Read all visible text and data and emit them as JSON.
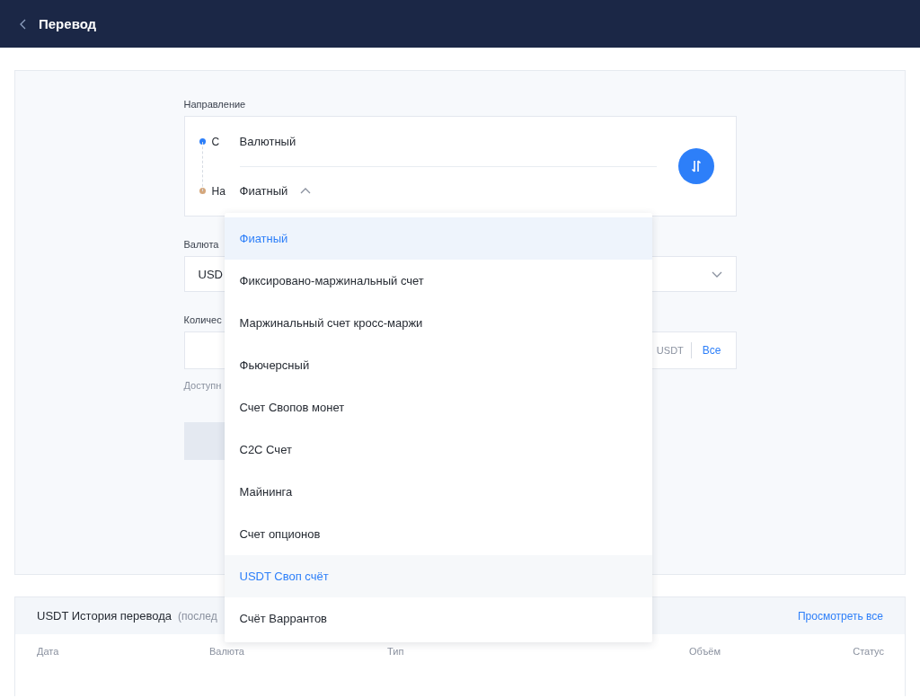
{
  "header": {
    "title": "Перевод"
  },
  "direction": {
    "label": "Направление",
    "from": {
      "prefix": "С",
      "account": "Валютный"
    },
    "to": {
      "prefix": "На",
      "account": "Фиатный",
      "expanded": true
    },
    "options": [
      {
        "label": "Фиатный",
        "selected": true,
        "hovered": false
      },
      {
        "label": "Фиксировано-маржинальный счет",
        "selected": false,
        "hovered": false
      },
      {
        "label": "Маржинальный счет кросс-маржи",
        "selected": false,
        "hovered": false
      },
      {
        "label": "Фьючерсный",
        "selected": false,
        "hovered": false
      },
      {
        "label": "Счет Свопов монет",
        "selected": false,
        "hovered": false
      },
      {
        "label": "C2C Счет",
        "selected": false,
        "hovered": false
      },
      {
        "label": "Майнинга",
        "selected": false,
        "hovered": false
      },
      {
        "label": "Счет опционов",
        "selected": false,
        "hovered": false
      },
      {
        "label": "USDT Своп счёт",
        "selected": false,
        "hovered": true
      },
      {
        "label": "Счёт Варрантов",
        "selected": false,
        "hovered": false
      }
    ]
  },
  "currency": {
    "label": "Валюта",
    "value": "USD"
  },
  "amount": {
    "label": "Количес",
    "unit": "USDT",
    "all_button": "Все"
  },
  "available": "Доступн",
  "history": {
    "title": "USDT История перевода",
    "subtitle": "(послед",
    "view_all": "Просмотреть все",
    "columns": [
      "Дата",
      "Валюта",
      "Тип",
      "Объём",
      "Статус"
    ]
  }
}
